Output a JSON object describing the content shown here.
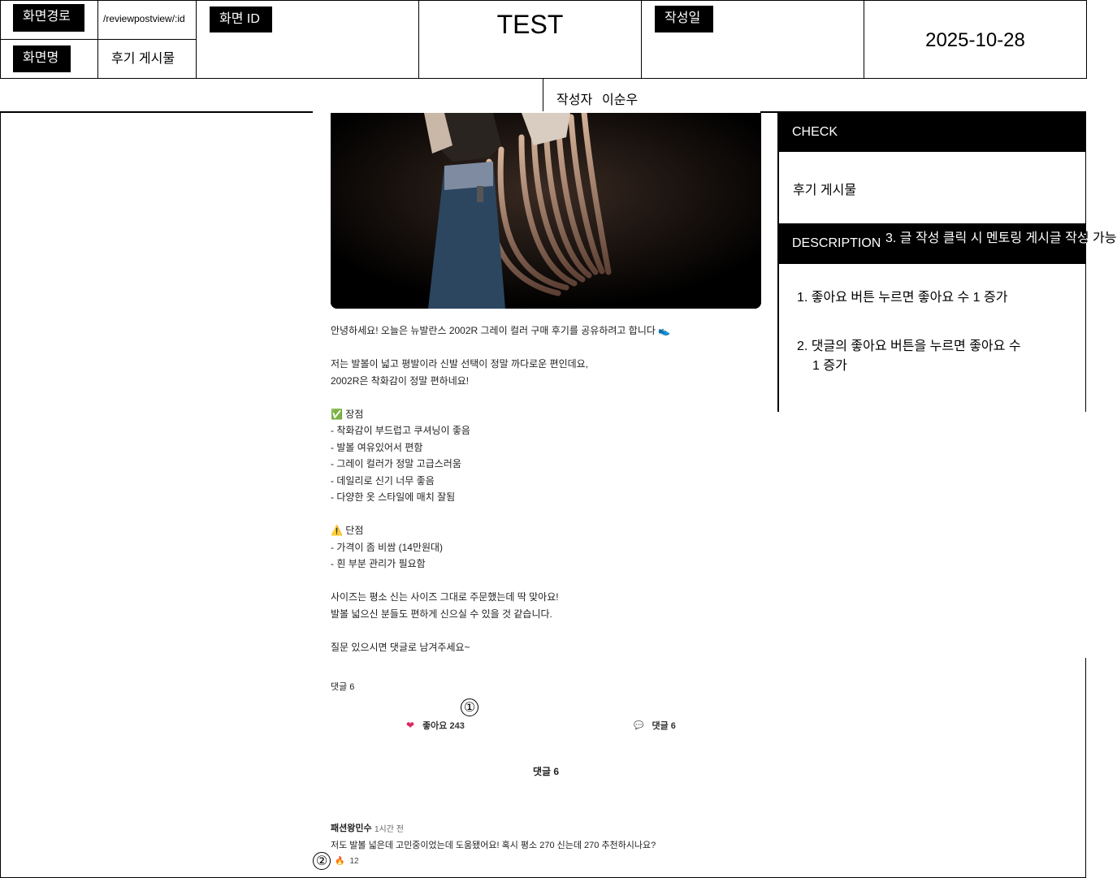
{
  "header": {
    "path_label": "화면경로",
    "path_value": "/reviewpostview/:id",
    "name_label": "화면명",
    "name_value": "후기 게시물",
    "id_label": "화면 ID",
    "id_value": "",
    "test_label": "TEST",
    "date_label": "작성일",
    "date_value": "2025-10-28",
    "author_label": "작성자",
    "author_value": "이순우"
  },
  "post": {
    "lines": [
      "안녕하세요! 오늘은 뉴발란스 2002R 그레이 컬러 구매 후기를 공유하려고 합니다 👟",
      "",
      "저는 발볼이 넓고 평발이라 신발 선택이 정말 까다로운 편인데요,",
      "2002R은 착화감이 정말 편하네요!",
      "",
      "✅ 장점",
      "- 착화감이 부드럽고 쿠셔닝이 좋음",
      "- 발볼 여유있어서 편함",
      "- 그레이 컬러가 정말 고급스러움",
      "- 데일리로 신기 너무 좋음",
      "- 다양한 옷 스타일에 매치 잘됨",
      "",
      "⚠️ 단점",
      "- 가격이 좀 비쌈 (14만원대)",
      "- 흰 부분 관리가 필요함",
      "",
      "사이즈는 평소 신는 사이즈 그대로 주문했는데 딱 맞아요!",
      "발볼 넓으신 분들도 편하게 신으실 수 있을 것 같습니다.",
      "",
      "질문 있으시면 댓글로 남겨주세요~"
    ],
    "comment_count_label": "댓글 6",
    "like_icon": "heart-icon",
    "like_label": "좋아요 243",
    "comment_icon": "speech-bubble-icon",
    "comment_label": "댓글 6",
    "comments_heading": "댓글 6",
    "comment": {
      "author": "패션왕민수",
      "time": "1시간 전",
      "text": "저도 발볼 넓은데 고민중이었는데 도움됐어요! 혹시 평소 270 신는데 270 추천하시나요?",
      "like_icon": "fire-icon",
      "likes": "12"
    }
  },
  "markers": {
    "one": "①",
    "two": "②"
  },
  "side": {
    "check_title": "CHECK",
    "check_value": "후기 게시물",
    "description_title": "DESCRIPTION",
    "description_items": [
      "1. 좋아요 버튼 누르면 좋아요 수 1 증가",
      "2. 댓글의 좋아요 버튼을 누르면 좋아요 수",
      "1 증가"
    ],
    "overflow_note": "3. 글 작성 클릭 시 멘토링 게시글 작성 가능"
  }
}
